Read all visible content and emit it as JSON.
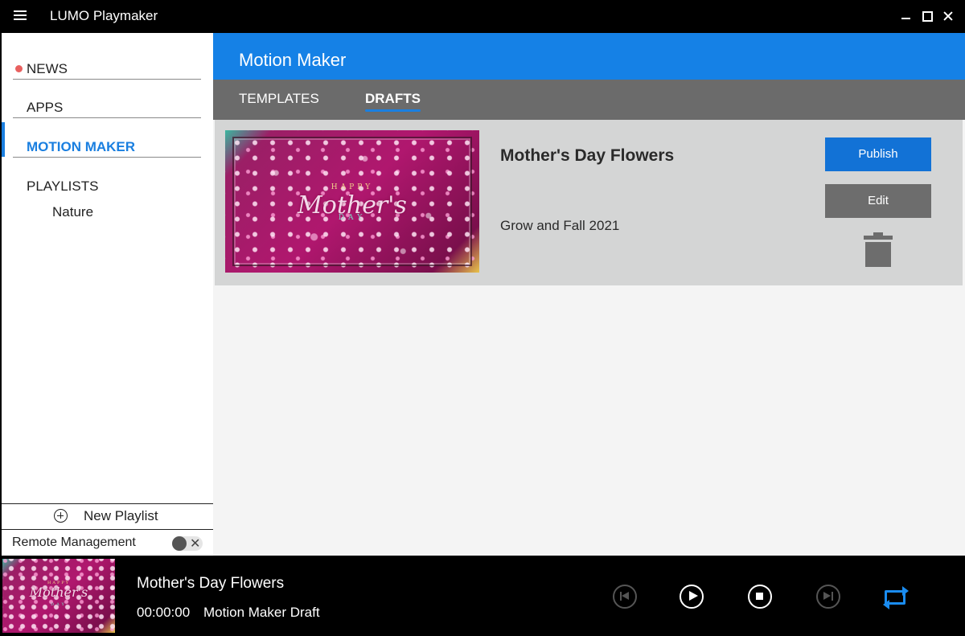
{
  "window": {
    "title": "LUMO Playmaker",
    "icons": {
      "menu": "hamburger-icon",
      "minimize": "minimize-icon",
      "maximize": "maximize-icon",
      "close": "close-icon"
    }
  },
  "sidebar": {
    "items": [
      {
        "label": "NEWS",
        "badge": "red-dot"
      },
      {
        "label": "APPS"
      },
      {
        "label": "MOTION MAKER",
        "active": true
      },
      {
        "label": "PLAYLISTS"
      }
    ],
    "sub_items": [
      {
        "label": "Nature"
      }
    ],
    "new_playlist_label": "New Playlist",
    "remote_label": "Remote Management",
    "remote_enabled": false
  },
  "main": {
    "title": "Motion Maker",
    "tabs": [
      {
        "label": "TEMPLATES",
        "active": false
      },
      {
        "label": "DRAFTS",
        "active": true
      }
    ],
    "drafts": [
      {
        "title": "Mother's Day Flowers",
        "subtitle": "Grow and Fall 2021",
        "thumbnail_text": {
          "happy": "HAPPY",
          "mother": "Mother's",
          "day": "DAY"
        },
        "publish_label": "Publish",
        "edit_label": "Edit",
        "delete_icon": "trash-icon"
      }
    ]
  },
  "player": {
    "title": "Mother's Day Flowers",
    "time": "00:00:00",
    "source": "Motion Maker Draft",
    "controls": [
      "skip-previous-icon",
      "play-icon",
      "stop-icon",
      "skip-next-icon",
      "repeat-icon"
    ]
  },
  "colors": {
    "accent": "#1581e6",
    "tab_bar": "#6b6b6b",
    "publish": "#1272d6",
    "edit": "#6d6d6d",
    "news_dot": "#e8605f",
    "repeat_active": "#1a8cf0"
  }
}
